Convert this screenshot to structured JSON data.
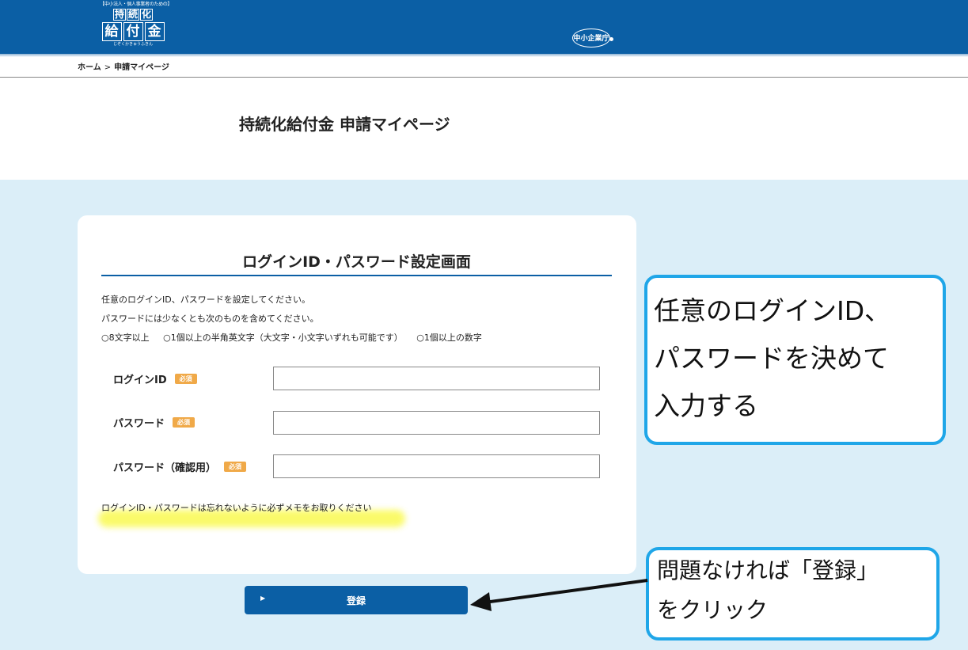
{
  "header": {
    "logo_top": "【中小法人・個人事業者のための】",
    "logo_row1": [
      "持",
      "続",
      "化"
    ],
    "logo_row2": [
      "給",
      "付",
      "金"
    ],
    "logo_bottom": "じぞくかきゅうふきん",
    "agency_logo": "中小企業庁",
    "brand_color": "#0b5fa5"
  },
  "breadcrumb": {
    "home": "ホーム",
    "separator": ">",
    "current": "申請マイページ"
  },
  "page_title": "持続化給付金 申請マイページ",
  "form": {
    "title": "ログインID・パスワード設定画面",
    "instructions": [
      "任意のログインID、パスワードを設定してください。",
      "パスワードには少なくとも次のものを含めてください。"
    ],
    "requirements": [
      "○8文字以上",
      "○1個以上の半角英文字（大文字・小文字いずれも可能です）",
      "○1個以上の数字"
    ],
    "required_badge": "必須",
    "fields": [
      {
        "label": "ログインID",
        "value": "",
        "placeholder": ""
      },
      {
        "label": "パスワード",
        "value": "",
        "placeholder": ""
      },
      {
        "label": "パスワード（確認用）",
        "value": "",
        "placeholder": ""
      }
    ],
    "memo_note": "ログインID・パスワードは忘れないように必ずメモをお取りください",
    "submit_arrow": "▶",
    "submit_label": "登録"
  },
  "annotations": {
    "callout1": [
      "任意のログインID、",
      "パスワードを決めて",
      "入力する"
    ],
    "callout2": [
      "問題なければ「登録」",
      "をクリック"
    ],
    "callout_border_color": "#1fa6e8",
    "highlight_color": "#fafa5a"
  }
}
